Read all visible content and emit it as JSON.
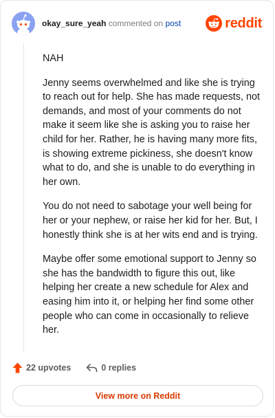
{
  "header": {
    "username": "okay_sure_yeah",
    "action_text": "commented on",
    "target_link": "post",
    "logo_text": "reddit"
  },
  "comment": {
    "paragraphs": [
      "NAH",
      "Jenny seems overwhelmed and like she is trying to reach out for help. She has made requests, not demands, and most of your comments do not make it seem like she is asking you to raise her child for her. Rather, he is having many more fits, is showing extreme pickiness, she doesn't know what to do, and she is unable to do everything in her own.",
      "You do not need to sabotage your well being for her or your nephew, or raise her kid for her. But, I honestly think she is at her wits end and is trying.",
      "Maybe offer some emotional support to Jenny so she has the bandwidth to figure this out, like helping her create a new schedule for Alex and easing him into it, or helping her find some other people who can come in occasionally to relieve her."
    ]
  },
  "footer": {
    "upvotes": "22 upvotes",
    "replies": "0 replies",
    "view_more": "View more on Reddit"
  },
  "colors": {
    "brand": "#ff4500",
    "link": "#0045ac",
    "avatar_bg": "#8aa2f0"
  },
  "icons": [
    "snoo-avatar-icon",
    "reddit-logo-icon",
    "upvote-arrow-icon",
    "reply-arrow-icon"
  ]
}
